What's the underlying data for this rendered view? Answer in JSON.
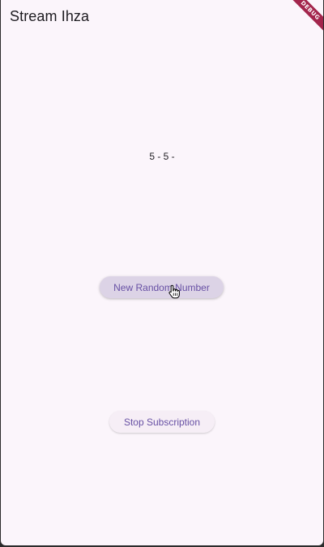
{
  "app": {
    "title": "Stream Ihza",
    "debug_banner": "DEBUG"
  },
  "main": {
    "value_text": "5 - 5 -",
    "random_button_label": "New Random Number",
    "stop_button_label": "Stop Subscription"
  },
  "colors": {
    "background": "#fbf5fb",
    "primary": "#6750a4",
    "debug_banner": "#a3254c"
  }
}
